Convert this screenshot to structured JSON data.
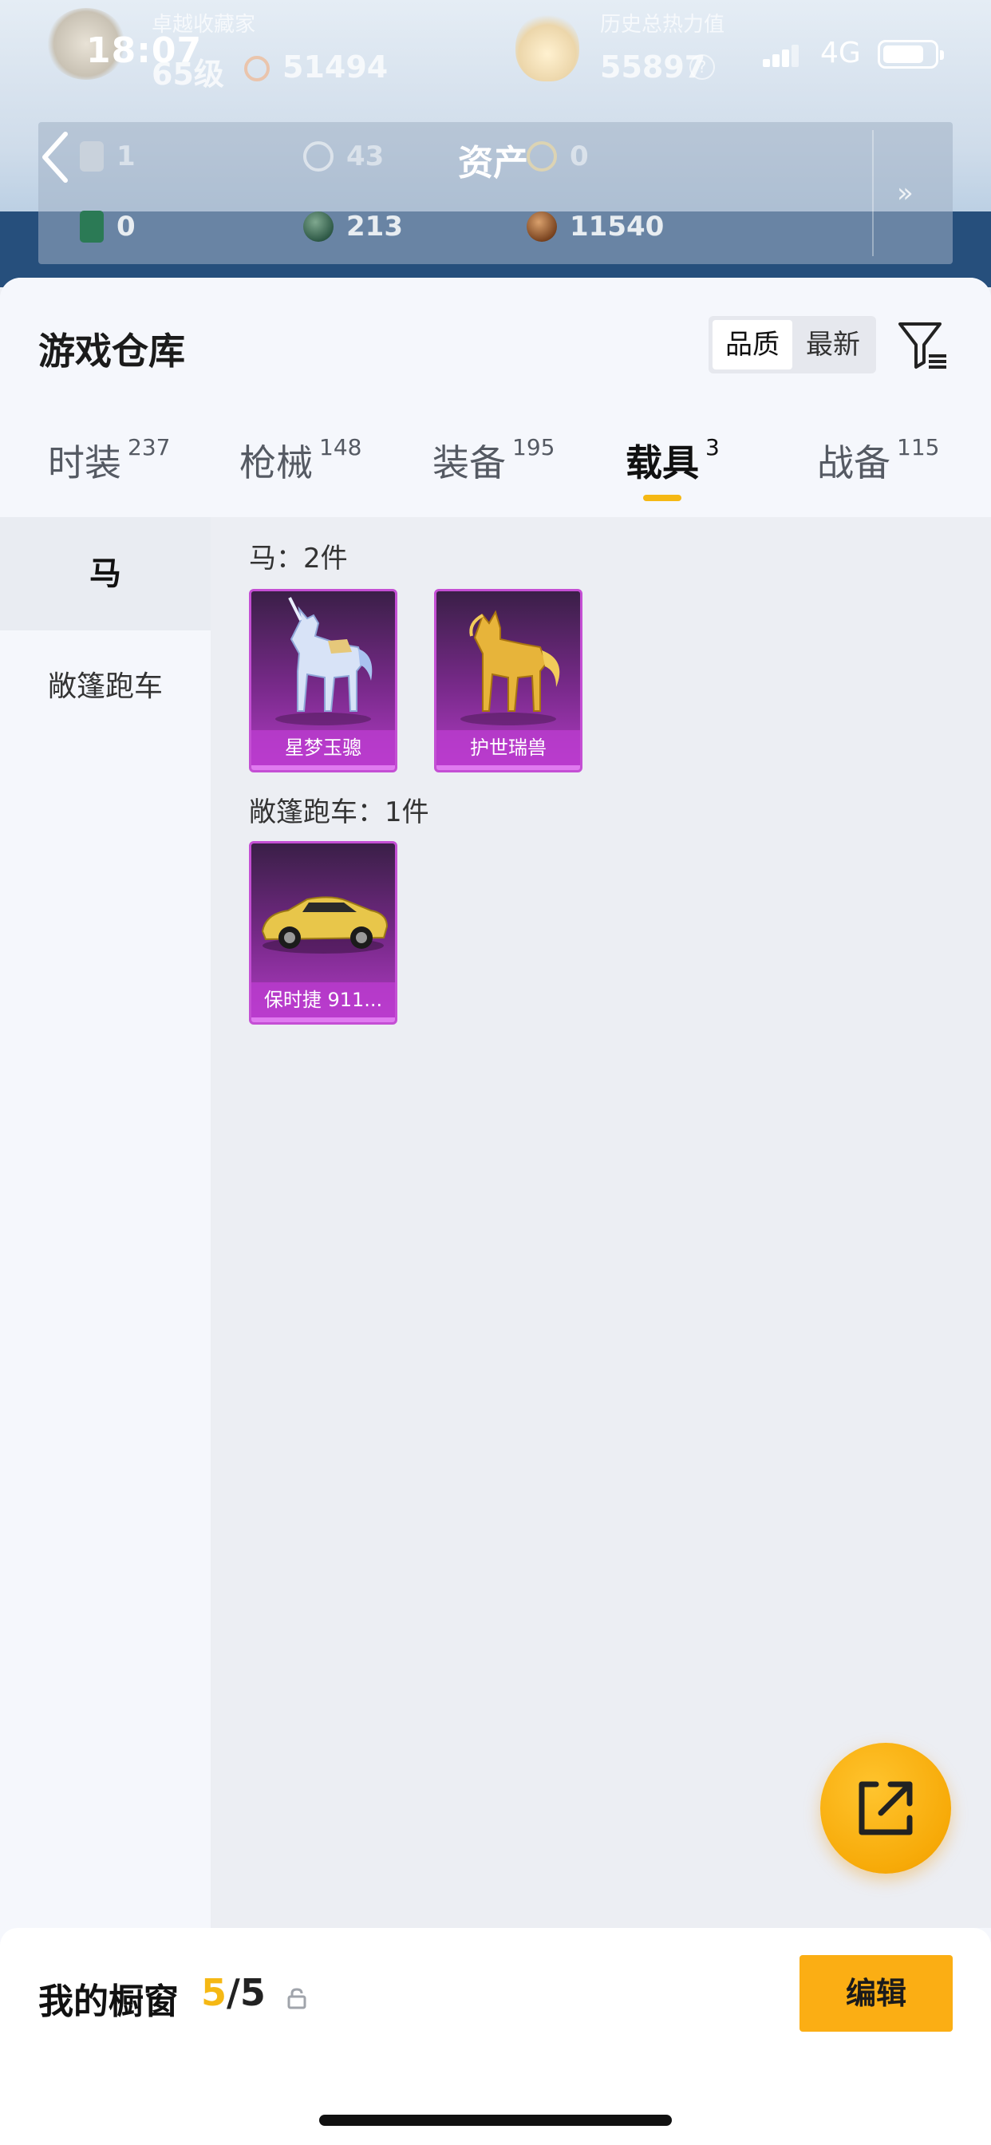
{
  "status_bar": {
    "time": "18:07",
    "network": "4G"
  },
  "header": {
    "collector_label": "卓越收藏家",
    "level": "65级",
    "coins": "51494",
    "heat_label": "历史总热力值",
    "heat_value": "55897",
    "heat_help": "?",
    "title": "资产",
    "assets_top": [
      {
        "icon": "card-icon",
        "value": "1"
      },
      {
        "icon": "clock-coin-icon",
        "value": "43"
      },
      {
        "icon": "gold-coin-icon",
        "value": "0"
      }
    ],
    "assets_bottom": [
      {
        "icon": "green-card-icon",
        "value": "0"
      },
      {
        "icon": "green-orb-icon",
        "value": "213"
      },
      {
        "icon": "bronze-coin-icon",
        "value": "11540"
      }
    ],
    "more_glyph": "»"
  },
  "warehouse": {
    "title": "游戏仓库",
    "sort_options": [
      "品质",
      "最新"
    ],
    "tabs": [
      {
        "label": "时装",
        "count": "237"
      },
      {
        "label": "枪械",
        "count": "148"
      },
      {
        "label": "装备",
        "count": "195"
      },
      {
        "label": "载具",
        "count": "3"
      },
      {
        "label": "战备",
        "count": "115"
      }
    ],
    "categories": [
      "马",
      "敞篷跑车"
    ],
    "groups": [
      {
        "title": "马：2件",
        "items": [
          {
            "name": "星梦玉骢"
          },
          {
            "name": "护世瑞兽"
          }
        ]
      },
      {
        "title": "敞篷跑车：1件",
        "items": [
          {
            "name": "保时捷 911..."
          }
        ]
      }
    ]
  },
  "showcase": {
    "label": "我的橱窗",
    "current": "5",
    "separator": "/",
    "total": "5",
    "edit_label": "编辑"
  },
  "colors": {
    "accent": "#F5B814",
    "edit_button": "#FBAE14",
    "card_purple": "#B13CC4"
  }
}
